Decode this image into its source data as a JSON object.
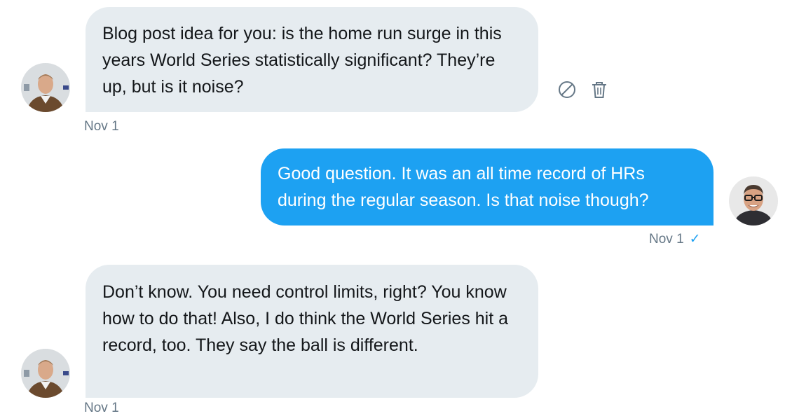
{
  "messages": [
    {
      "direction": "incoming",
      "text": "Blog post idea for you: is the home run surge in this years World Series statistically significant? They’re up, but is it noise?",
      "time": "Nov 1"
    },
    {
      "direction": "outgoing",
      "text": "Good question. It was an all time record of HRs during the regular season. Is that noise though?",
      "time": "Nov 1",
      "status_glyph": "✓"
    },
    {
      "direction": "incoming",
      "text": "Don’t know. You need control limits, right? You know how to do that! Also, I do think the World Series hit a record, too. They say the ball is different.",
      "time": "Nov 1"
    }
  ],
  "message_actions": [
    {
      "icon": "block-icon"
    },
    {
      "icon": "trash-icon"
    }
  ],
  "colors": {
    "incoming_bubble": "#e6ecf0",
    "outgoing_bubble": "#1da1f2",
    "timestamp": "#657786",
    "text": "#14171a"
  }
}
